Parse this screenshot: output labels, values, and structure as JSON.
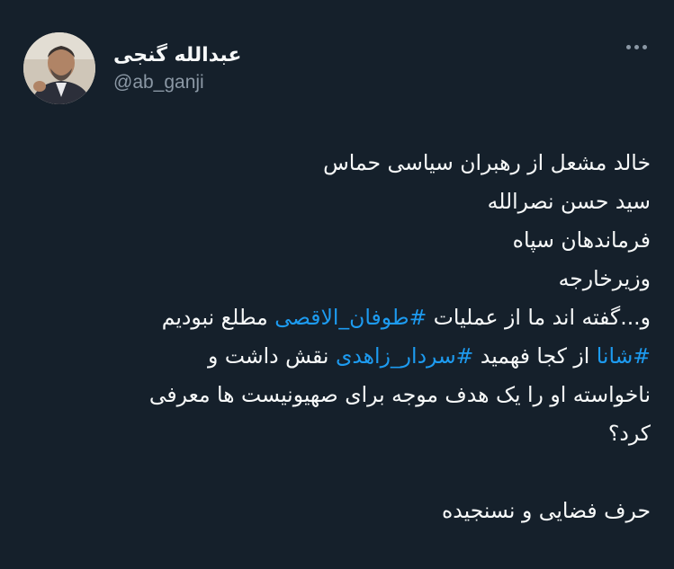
{
  "author": {
    "display_name": "عبدالله گنجی",
    "handle": "@ab_ganji",
    "avatar_icon": "profile-photo"
  },
  "menu_icon": "more-dots-icon",
  "tweet": {
    "line1": "خالد مشعل از رهبران سیاسی حماس",
    "line2": "سید حسن نصرالله",
    "line3": "فرماندهان سپاه",
    "line4": "وزیرخارجه",
    "line5_pre": "و...گفته اند ما از عملیات ",
    "line5_tag": "#طوفان_الاقصی",
    "line5_post": " مطلع نبودیم",
    "line6_tag1": "#شانا",
    "line6_mid": " از کجا فهمید ",
    "line6_tag2": "#سردار_زاهدی",
    "line6_post": " نقش داشت و",
    "line7": "ناخواسته او را یک هدف موجه برای صهیونیست ها معرفی",
    "line8": "کرد؟",
    "line9": "حرف فضایی و نسنجیده"
  },
  "colors": {
    "background": "#15202b",
    "text": "#f7f9f9",
    "secondary": "#8b98a5",
    "link": "#1d9bf0"
  }
}
